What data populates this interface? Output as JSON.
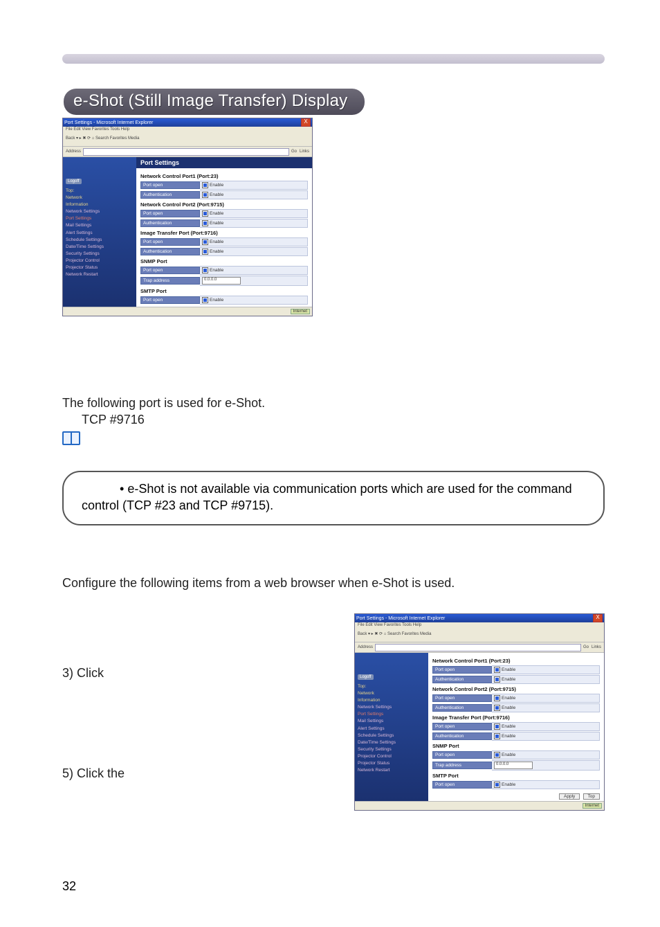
{
  "heading": "e-Shot (Still Image Transfer) Display",
  "body": {
    "line1": "The following port is used for e-Shot.",
    "line2": "TCP #9716",
    "configure": "Configure the following items from a web browser when e-Shot is used.",
    "step3": "3) Click",
    "step5": "5) Click the"
  },
  "note": "• e-Shot is not available via communication ports which are used for the command control (TCP #23 and TCP #9715).",
  "page_number": "32",
  "browser": {
    "titlebar": "Port Settings - Microsoft Internet Explorer",
    "close": "X",
    "menubar": "File  Edit  View  Favorites  Tools  Help",
    "toolbar": "Back  ▾  ▸  ✖  ⟳  ⌂  Search  Favorites  Media",
    "address_label": "Address",
    "go": "Go",
    "links": "Links",
    "status_internet": "Internet"
  },
  "sidebar": {
    "logoff": "Logoff",
    "top": "Top:",
    "network": "Network",
    "information": "Information",
    "items": [
      "Network Settings",
      "Port Settings",
      "Mail Settings",
      "Alert Settings",
      "Schedule Settings",
      "Date/Time Settings",
      "Security Settings",
      "Projector Control",
      "Projector Status",
      "Network Restart"
    ]
  },
  "panel": {
    "title": "Port Settings",
    "sections": [
      {
        "label": "Network Control Port1 (Port:23)",
        "rows": [
          {
            "l": "Port open",
            "r_enable": "Enable"
          },
          {
            "l": "Authentication",
            "r_enable": "Enable"
          }
        ]
      },
      {
        "label": "Network Control Port2 (Port:9715)",
        "rows": [
          {
            "l": "Port open",
            "r_enable": "Enable"
          },
          {
            "l": "Authentication",
            "r_enable": "Enable"
          }
        ]
      },
      {
        "label": "Image Transfer Port (Port:9716)",
        "rows": [
          {
            "l": "Port open",
            "r_enable": "Enable"
          },
          {
            "l": "Authentication",
            "r_enable": "Enable"
          }
        ]
      },
      {
        "label": "SNMP Port",
        "rows": [
          {
            "l": "Port open",
            "r_enable": "Enable"
          },
          {
            "l": "Trap address",
            "r_input": "0.0.0.0"
          }
        ]
      },
      {
        "label": "SMTP Port",
        "rows": [
          {
            "l": "Port open",
            "r_enable": "Enable"
          }
        ]
      }
    ],
    "apply": "Apply",
    "top_btn": "Top"
  }
}
